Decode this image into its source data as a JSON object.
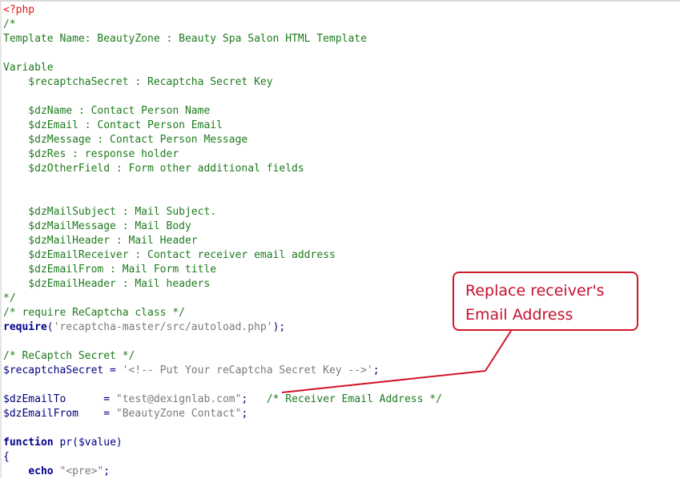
{
  "code_lines": [
    [
      {
        "c": "t-tag",
        "t": "<?php"
      }
    ],
    [
      {
        "c": "t-cm",
        "t": "/*"
      }
    ],
    [
      {
        "c": "t-cm",
        "t": "Template Name: BeautyZone : Beauty Spa Salon HTML Template"
      }
    ],
    [
      {
        "c": "t-cm",
        "t": ""
      }
    ],
    [
      {
        "c": "t-cm",
        "t": "Variable"
      }
    ],
    [
      {
        "c": "t-cm",
        "t": "    $recaptchaSecret : Recaptcha Secret Key"
      }
    ],
    [
      {
        "c": "t-cm",
        "t": ""
      }
    ],
    [
      {
        "c": "t-cm",
        "t": "    $dzName : Contact Person Name"
      }
    ],
    [
      {
        "c": "t-cm",
        "t": "    $dzEmail : Contact Person Email"
      }
    ],
    [
      {
        "c": "t-cm",
        "t": "    $dzMessage : Contact Person Message"
      }
    ],
    [
      {
        "c": "t-cm",
        "t": "    $dzRes : response holder"
      }
    ],
    [
      {
        "c": "t-cm",
        "t": "    $dzOtherField : Form other additional fields"
      }
    ],
    [
      {
        "c": "t-cm",
        "t": ""
      }
    ],
    [
      {
        "c": "t-cm",
        "t": ""
      }
    ],
    [
      {
        "c": "t-cm",
        "t": "    $dzMailSubject : Mail Subject."
      }
    ],
    [
      {
        "c": "t-cm",
        "t": "    $dzMailMessage : Mail Body"
      }
    ],
    [
      {
        "c": "t-cm",
        "t": "    $dzMailHeader : Mail Header"
      }
    ],
    [
      {
        "c": "t-cm",
        "t": "    $dzEmailReceiver : Contact receiver email address"
      }
    ],
    [
      {
        "c": "t-cm",
        "t": "    $dzEmailFrom : Mail Form title"
      }
    ],
    [
      {
        "c": "t-cm",
        "t": "    $dzEmailHeader : Mail headers"
      }
    ],
    [
      {
        "c": "t-cm",
        "t": "*/"
      }
    ],
    [
      {
        "c": "t-cm",
        "t": "/* require ReCaptcha class */"
      }
    ],
    [
      {
        "c": "t-kw",
        "t": "require"
      },
      {
        "c": "t-op",
        "t": "("
      },
      {
        "c": "t-str",
        "t": "'recaptcha-master/src/autoload.php'"
      },
      {
        "c": "t-op",
        "t": ");"
      }
    ],
    [
      {
        "c": "t-cm",
        "t": ""
      }
    ],
    [
      {
        "c": "t-cm",
        "t": "/* ReCaptch Secret */"
      }
    ],
    [
      {
        "c": "t-var",
        "t": "$recaptchaSecret"
      },
      {
        "c": "t-op",
        "t": " = "
      },
      {
        "c": "t-str",
        "t": "'<!-- Put Your reCaptcha Secret Key -->'"
      },
      {
        "c": "t-op",
        "t": ";"
      }
    ],
    [
      {
        "c": "t-cm",
        "t": ""
      }
    ],
    [
      {
        "c": "t-var",
        "t": "$dzEmailTo"
      },
      {
        "c": "t-op",
        "t": "      = "
      },
      {
        "c": "t-str",
        "t": "\"test@dexignlab.com\""
      },
      {
        "c": "t-op",
        "t": ";"
      },
      {
        "c": "t-cm",
        "t": "   /* Receiver Email Address */"
      }
    ],
    [
      {
        "c": "t-var",
        "t": "$dzEmailFrom"
      },
      {
        "c": "t-op",
        "t": "    = "
      },
      {
        "c": "t-str",
        "t": "\"BeautyZone Contact\""
      },
      {
        "c": "t-op",
        "t": ";"
      }
    ],
    [
      {
        "c": "t-cm",
        "t": ""
      }
    ],
    [
      {
        "c": "t-kw",
        "t": "function"
      },
      {
        "c": "t-fn",
        "t": " pr"
      },
      {
        "c": "t-op",
        "t": "("
      },
      {
        "c": "t-var",
        "t": "$value"
      },
      {
        "c": "t-op",
        "t": ")"
      }
    ],
    [
      {
        "c": "t-op",
        "t": "{"
      }
    ],
    [
      {
        "c": "t-plain",
        "t": "    "
      },
      {
        "c": "t-kw",
        "t": "echo"
      },
      {
        "c": "t-op",
        "t": " "
      },
      {
        "c": "t-str",
        "t": "\"<pre>\""
      },
      {
        "c": "t-op",
        "t": ";"
      }
    ]
  ],
  "callout": {
    "line1": "Replace receiver's",
    "line2": "Email Address"
  },
  "colors": {
    "comment": "#1e7b1e",
    "keyword": "#00008b",
    "variable": "#000080",
    "string": "#7a7a7a",
    "php_tag": "#e01b1b",
    "callout": "#d3162a"
  }
}
